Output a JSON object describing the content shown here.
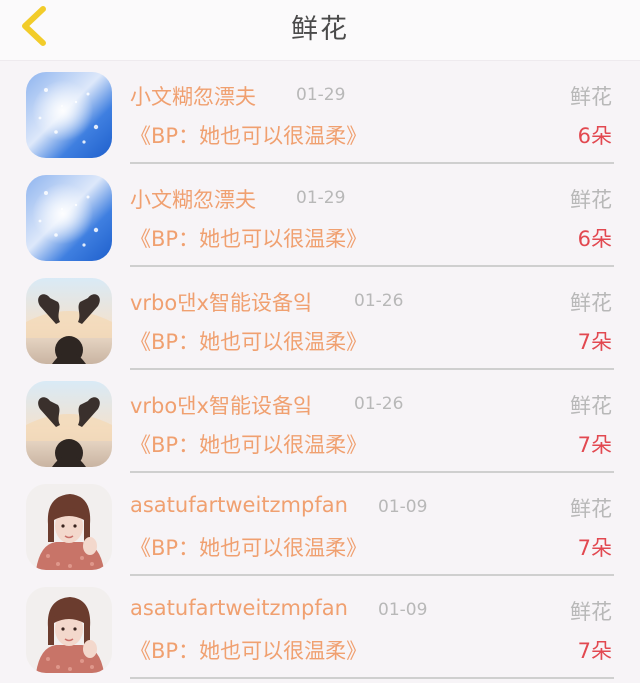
{
  "header": {
    "title": "鲜花",
    "back_icon": "chevron-left-icon",
    "back_color": "#f2cc2a"
  },
  "rows": [
    {
      "user": "小文糊忽漂夫",
      "date": "01-29",
      "gift": "鲜花",
      "post": "《BP：她也可以很温柔》",
      "count": "6朵",
      "avatar": "sparkle-blue"
    },
    {
      "user": "小文糊忽漂夫",
      "date": "01-29",
      "gift": "鲜花",
      "post": "《BP：她也可以很温柔》",
      "count": "6朵",
      "avatar": "sparkle-blue"
    },
    {
      "user": "vrbo댄x智能设备잌",
      "date": "01-26",
      "gift": "鲜花",
      "post": "《BP：她也可以很温柔》",
      "count": "7朵",
      "avatar": "heart-hands-concert"
    },
    {
      "user": "vrbo댄x智能设备잌",
      "date": "01-26",
      "gift": "鲜花",
      "post": "《BP：她也可以很温柔》",
      "count": "7朵",
      "avatar": "heart-hands-concert"
    },
    {
      "user": "asatufartweitzmpfan",
      "date": "01-09",
      "gift": "鲜花",
      "post": "《BP：她也可以很温柔》",
      "count": "7朵",
      "avatar": "girl-portrait"
    },
    {
      "user": "asatufartweitzmpfan",
      "date": "01-09",
      "gift": "鲜花",
      "post": "《BP：她也可以很温柔》",
      "count": "7朵",
      "avatar": "girl-portrait"
    }
  ],
  "colors": {
    "username": "#f0a070",
    "count": "#e24850",
    "muted": "#b8b8b8"
  }
}
